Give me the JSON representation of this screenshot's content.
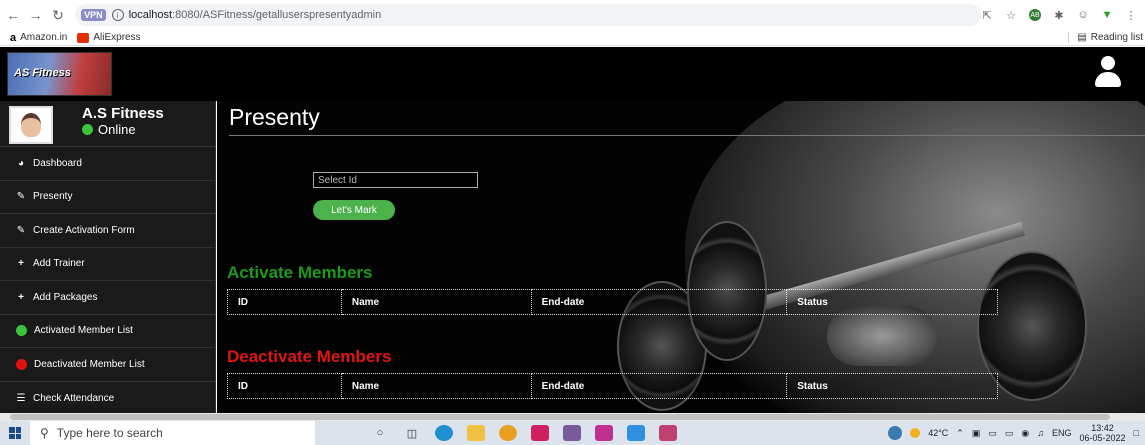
{
  "browser": {
    "vpn_badge": "VPN",
    "url_host": "localhost",
    "url_path": ":8080/ASFitness/getalluserspresentyadmin",
    "bookmarks": [
      {
        "label": "Amazon.in"
      },
      {
        "label": "AliExpress"
      }
    ],
    "reading_list": "Reading list"
  },
  "header": {
    "logo_text": "AS Fitness"
  },
  "profile": {
    "name": "A.S Fitness",
    "status": "Online"
  },
  "sidebar": {
    "items": [
      {
        "label": "Dashboard",
        "icon": "tachometer-icon"
      },
      {
        "label": "Presenty",
        "icon": "pencil-icon"
      },
      {
        "label": "Create Activation Form",
        "icon": "pencil-icon"
      },
      {
        "label": "Add Trainer",
        "icon": "plus-icon"
      },
      {
        "label": "Add Packages",
        "icon": "plus-icon"
      },
      {
        "label": "Activated Member List",
        "icon": "green-dot-icon"
      },
      {
        "label": "Deactivated Member List",
        "icon": "red-dot-icon"
      },
      {
        "label": "Check Attendance",
        "icon": "list-icon"
      }
    ]
  },
  "main": {
    "title": "Presenty",
    "select_placeholder": "Select Id",
    "mark_button": "Let's Mark",
    "active_title": "Activate Members",
    "deactive_title": "Deactivate Members",
    "columns": [
      "ID",
      "Name",
      "End-date",
      "Status"
    ]
  },
  "taskbar": {
    "search_placeholder": "Type here to search",
    "temperature": "42°C",
    "language": "ENG",
    "time": "13:42",
    "date": "06-05-2022"
  },
  "colors": {
    "active_title": "#1c9a1c",
    "deactive_title": "#e01414",
    "mark_button": "#4cb24c"
  }
}
